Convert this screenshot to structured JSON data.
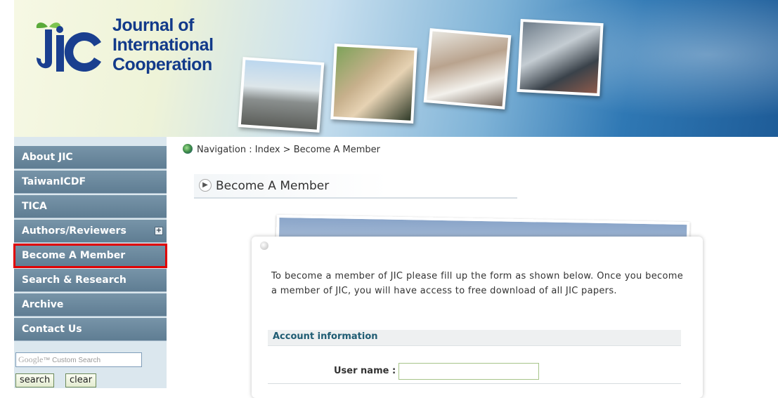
{
  "header": {
    "logo_lines": [
      "Journal of",
      "International",
      "Cooperation"
    ],
    "logo_mark_letters": "JIC",
    "colors": {
      "logo_text": "#123a8a",
      "banner_blue": "#1e5c98"
    }
  },
  "sidebar": {
    "items": [
      {
        "label": "About JIC"
      },
      {
        "label": "TaiwanICDF"
      },
      {
        "label": "TICA"
      },
      {
        "label": "Authors/Reviewers",
        "expand_icon": "plus-icon"
      },
      {
        "label": "Become A Member",
        "highlighted": true
      },
      {
        "label": "Search & Research"
      },
      {
        "label": "Archive"
      },
      {
        "label": "Contact Us"
      }
    ],
    "search": {
      "placeholder_brand": "Google",
      "placeholder_text": "™ Custom Search",
      "search_label": "search",
      "clear_label": "clear"
    },
    "colors": {
      "nav_bg": "#6a879c",
      "highlight_border": "#e00000"
    }
  },
  "breadcrumb": {
    "text": "Navigation : Index > Become A Member",
    "icon": "globe-icon"
  },
  "page": {
    "title": "Become A Member",
    "intro": "To become a member of JIC please fill up the form as shown below. Once you become a member of JIC, you will have access to free download of all JIC papers.",
    "section_title": "Account information",
    "fields": [
      {
        "label": "User name :",
        "value": ""
      }
    ],
    "colors": {
      "section_title": "#1f5c73"
    }
  }
}
